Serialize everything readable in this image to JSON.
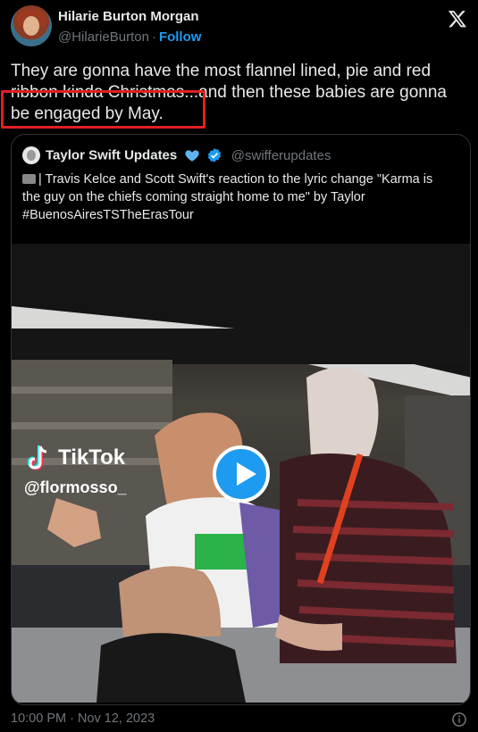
{
  "author": {
    "name": "Hilarie Burton Morgan",
    "handle": "@HilarieBurton",
    "separator": "·",
    "follow_label": "Follow"
  },
  "tweet": {
    "line1": "They are gonna have the most flannel lined, pie and red",
    "line2": "ribbon kinda Christmas...and then these babies are gonna",
    "line3": "be engaged by May."
  },
  "quote": {
    "name": "Taylor Swift Updates",
    "handle": "@swifferupdates",
    "line1": "| Travis Kelce and Scott Swift's reaction to the lyric change \"Karma is",
    "line2": "the guy on the chiefs coming straight home to me\" by Taylor",
    "line3": "#BuenosAiresTSTheErasTour"
  },
  "video": {
    "watermark_brand": "TikTok",
    "watermark_user": "@flormosso_"
  },
  "footer": {
    "timestamp": "10:00 PM · Nov 12, 2023"
  },
  "icons": {
    "platform": "x-logo-icon",
    "heart": "blue-heart-icon",
    "verified": "verified-badge-icon",
    "info": "info-icon",
    "play": "play-icon"
  },
  "colors": {
    "background": "#000000",
    "text": "#e7e9ea",
    "secondary": "#71767b",
    "accent": "#1d9bf0",
    "highlight": "#e02020"
  }
}
